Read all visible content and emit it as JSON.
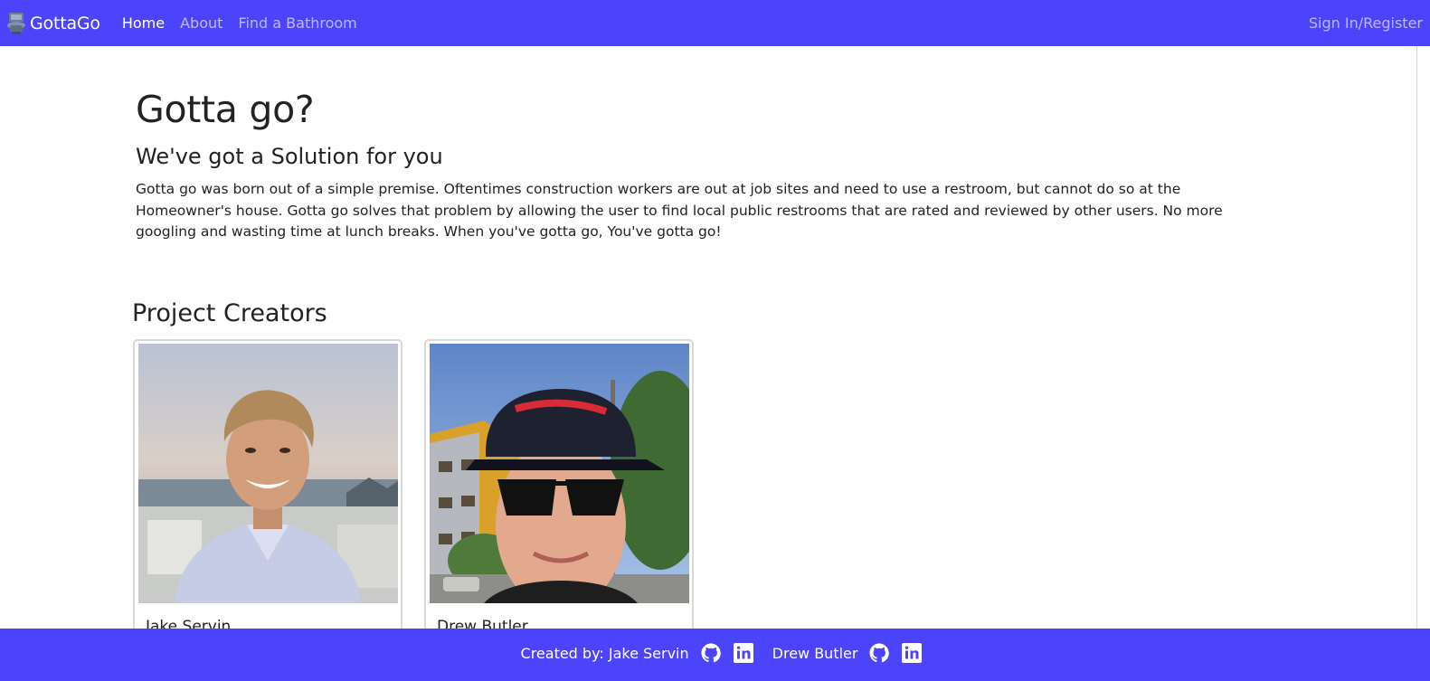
{
  "nav": {
    "brand": "GottaGo",
    "links": [
      {
        "label": "Home",
        "active": true
      },
      {
        "label": "About",
        "active": false
      },
      {
        "label": "Find a Bathroom",
        "active": false
      }
    ],
    "sign_in": "Sign In/Register"
  },
  "hero": {
    "title": "Gotta go?",
    "subtitle": "We've got a Solution for you",
    "body": "Gotta go was born out of a simple premise. Oftentimes construction workers are out at job sites and need to use a restroom, but cannot do so at the Homeowner's house. Gotta go solves that problem by allowing the user to find local public restrooms that are rated and reviewed by other users. No more googling and wasting time at lunch breaks. When you've gotta go, You've gotta go!"
  },
  "creators": {
    "title": "Project Creators",
    "cards": [
      {
        "name": "Jake Servin",
        "photo": "jake-servin-portrait"
      },
      {
        "name": "Drew Butler",
        "photo": "drew-butler-selfie"
      }
    ]
  },
  "footer": {
    "prefix": "Created by: Jake Servin",
    "second": "Drew Butler",
    "icons": [
      "github-icon",
      "linkedin-icon"
    ]
  },
  "colors": {
    "brand": "#4c44fa",
    "nav_inactive": "rgba(255,255,255,0.62)",
    "text": "#222222"
  }
}
